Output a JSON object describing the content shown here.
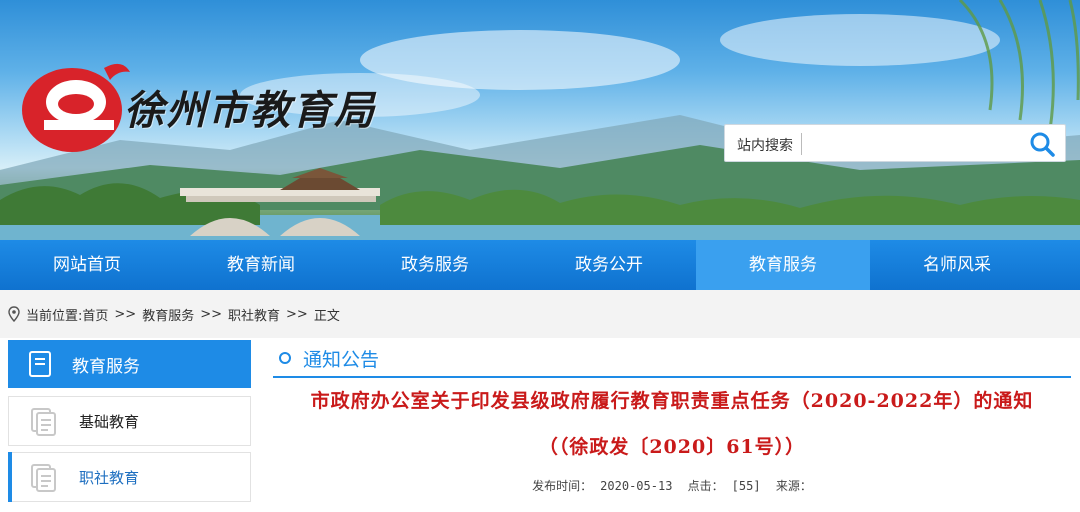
{
  "header": {
    "site_title": "徐州市教育局",
    "logo_letter": "e",
    "logo_icon": "e-logo-icon",
    "search": {
      "label": "站内搜索",
      "placeholder": "",
      "icon": "search-icon"
    }
  },
  "nav": {
    "items": [
      {
        "label": "网站首页",
        "active": false
      },
      {
        "label": "教育新闻",
        "active": false
      },
      {
        "label": "政务服务",
        "active": false
      },
      {
        "label": "政务公开",
        "active": false
      },
      {
        "label": "教育服务",
        "active": true
      },
      {
        "label": "名师风采",
        "active": false
      }
    ]
  },
  "breadcrumb": {
    "prefix": "当前位置:",
    "items": [
      "首页",
      "教育服务",
      "职社教育",
      "正文"
    ],
    "separator": ">>"
  },
  "sidebar": {
    "title": "教育服务",
    "items": [
      {
        "label": "基础教育",
        "active": false
      },
      {
        "label": "职社教育",
        "active": true
      }
    ]
  },
  "article": {
    "section": "通知公告",
    "title_line1": "市政府办公室关于印发县级政府履行教育职责重点任务（2020-2022年）的通知",
    "title_line2": "（（徐政发〔2020〕61号））",
    "meta": {
      "published_label": "发布时间：",
      "published_value": "2020-05-13",
      "clicks_label": "点击：",
      "clicks_value": "[55]",
      "source_label": "来源："
    }
  },
  "colors": {
    "nav_blue": "#1e8be6",
    "nav_active": "#3aa0ef",
    "title_red": "#c91a1a",
    "logo_red": "#d8232a"
  }
}
